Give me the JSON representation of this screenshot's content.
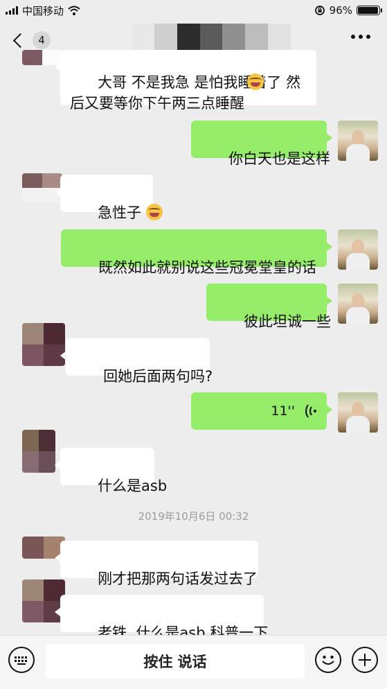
{
  "status": {
    "carrier": "中国移动",
    "battery_pct": "96%",
    "battery_level": 0.96
  },
  "nav": {
    "back_count": "4",
    "title_blurred": true
  },
  "colors": {
    "outgoing_bubble": "#95ec69",
    "incoming_bubble": "#ffffff",
    "background": "#ededed"
  },
  "messages": [
    {
      "side": "in",
      "text": "大哥 不是我急 是怕我睡着了 然\n后又要等你下午两三点睡醒",
      "emoji": "laughing-crying"
    },
    {
      "side": "out",
      "text": "你白天也是这样"
    },
    {
      "side": "in",
      "text": "急性子 ",
      "emoji": "laughing-crying"
    },
    {
      "side": "out",
      "text": "既然如此就别说这些冠冕堂皇的话"
    },
    {
      "side": "out",
      "text": "彼此坦诚一些"
    },
    {
      "side": "in",
      "text": "回她后面两句吗?"
    },
    {
      "side": "out",
      "voice_duration": "11''"
    },
    {
      "side": "in",
      "text": "什么是asb"
    },
    {
      "timestamp": "2019年10月6日 00:32"
    },
    {
      "side": "in",
      "text": "刚才把那两句话发过去了"
    },
    {
      "side": "in",
      "text": "老铁  什么是asb 科普一下"
    }
  ],
  "input": {
    "hold_to_talk": "按住 说话"
  },
  "icons": {
    "back": "chevron-left-icon",
    "more": "more-dots-icon",
    "keyboard": "keyboard-icon",
    "emoji": "emoji-icon",
    "plus": "plus-icon",
    "voice": "voice-wave-icon"
  }
}
